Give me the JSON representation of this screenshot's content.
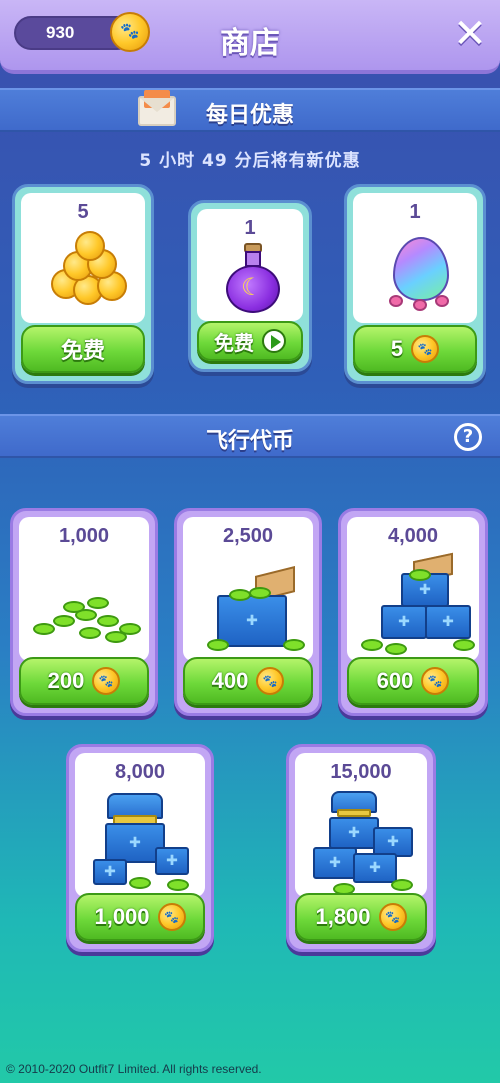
{
  "header": {
    "coin_balance": "930",
    "title": "商店",
    "close_icon": "close-icon",
    "coin_icon": "paw-coin-icon"
  },
  "daily": {
    "title": "每日优惠",
    "timer": "5 小时 49 分后将有新优惠",
    "items": [
      {
        "qty": "5",
        "art": "gold-coins",
        "button": "免费",
        "button_icon": "none"
      },
      {
        "qty": "1",
        "art": "magic-potion",
        "button": "免费",
        "button_icon": "play-video-icon"
      },
      {
        "qty": "1",
        "art": "rainbow-egg",
        "button": "5",
        "button_icon": "paw-coin-icon"
      }
    ]
  },
  "tokens": {
    "title": "飞行代币",
    "help_icon": "help-icon",
    "items": [
      {
        "qty": "1,000",
        "price": "200"
      },
      {
        "qty": "2,500",
        "price": "400"
      },
      {
        "qty": "4,000",
        "price": "600"
      },
      {
        "qty": "8,000",
        "price": "1,000"
      },
      {
        "qty": "15,000",
        "price": "1,800"
      }
    ]
  },
  "footer": {
    "copyright": "© 2010-2020 Outfit7 Limited. All rights reserved."
  },
  "colors": {
    "accent_purple": "#ae96ee",
    "button_green": "#6ed93a",
    "coin_gold": "#ffc829"
  }
}
